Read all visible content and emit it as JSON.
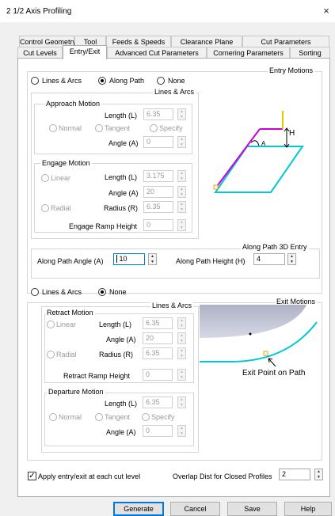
{
  "window": {
    "title": "2 1/2 Axis Profiling",
    "close_glyph": "×"
  },
  "tabs_row1": [
    "Control Geometry",
    "Tool",
    "Feeds & Speeds",
    "Clearance Plane",
    "Cut Parameters"
  ],
  "tabs_row2": [
    "Cut Levels",
    "Entry/Exit",
    "Advanced Cut Parameters",
    "Cornering Parameters",
    "Sorting"
  ],
  "entry": {
    "group_title": "Entry Motions",
    "mode_options": [
      "Lines & Arcs",
      "Along Path",
      "None"
    ],
    "lines_arcs_title": "Lines & Arcs",
    "approach": {
      "title": "Approach Motion",
      "length_label": "Length (L)",
      "length_value": "6.35",
      "options": [
        "Normal",
        "Tangent",
        "Specify"
      ],
      "angle_label": "Angle (A)",
      "angle_value": "0"
    },
    "engage": {
      "title": "Engage Motion",
      "linear": "Linear",
      "radial": "Radial",
      "length_label": "Length (L)",
      "length_value": "3.175",
      "angle_label": "Angle (A)",
      "angle_value": "20",
      "radius_label": "Radius (R)",
      "radius_value": "6.35",
      "ramp_label": "Engage Ramp Height",
      "ramp_value": "0"
    },
    "along_path": {
      "title": "Along Path 3D Entry",
      "angle_label": "Along Path Angle (A)",
      "angle_value": "10",
      "height_label": "Along Path Height (H)",
      "height_value": "4"
    },
    "diagram_labels": {
      "h": "H",
      "a": "A"
    }
  },
  "exit": {
    "group_title": "Exit Motions",
    "mode_options": [
      "Lines & Arcs",
      "None"
    ],
    "lines_arcs_title": "Lines & Arcs",
    "retract": {
      "title": "Retract Motion",
      "linear": "Linear",
      "radial": "Radial",
      "length_label": "Length (L)",
      "length_value": "6.35",
      "angle_label": "Angle (A)",
      "angle_value": "20",
      "radius_label": "Radius (R)",
      "radius_value": "6.35",
      "ramp_label": "Retract Ramp Height",
      "ramp_value": "0"
    },
    "departure": {
      "title": "Departure Motion",
      "length_label": "Length (L)",
      "length_value": "6.35",
      "options": [
        "Normal",
        "Tangent",
        "Specify"
      ],
      "angle_label": "Angle (A)",
      "angle_value": "0"
    },
    "diagram_label": "Exit Point on Path"
  },
  "bottom": {
    "apply_label": "Apply entry/exit at each cut level",
    "apply_checked": true,
    "overlap_label": "Overlap Dist for Closed Profiles",
    "overlap_value": "2"
  },
  "buttons": {
    "generate": "Generate",
    "cancel": "Cancel",
    "save": "Save",
    "help": "Help"
  },
  "colors": {
    "accent": "#0078d7",
    "magenta": "#d000d0",
    "cyan": "#00c8d8",
    "yellow": "#e8c800",
    "surface": "#c8ccdc"
  }
}
